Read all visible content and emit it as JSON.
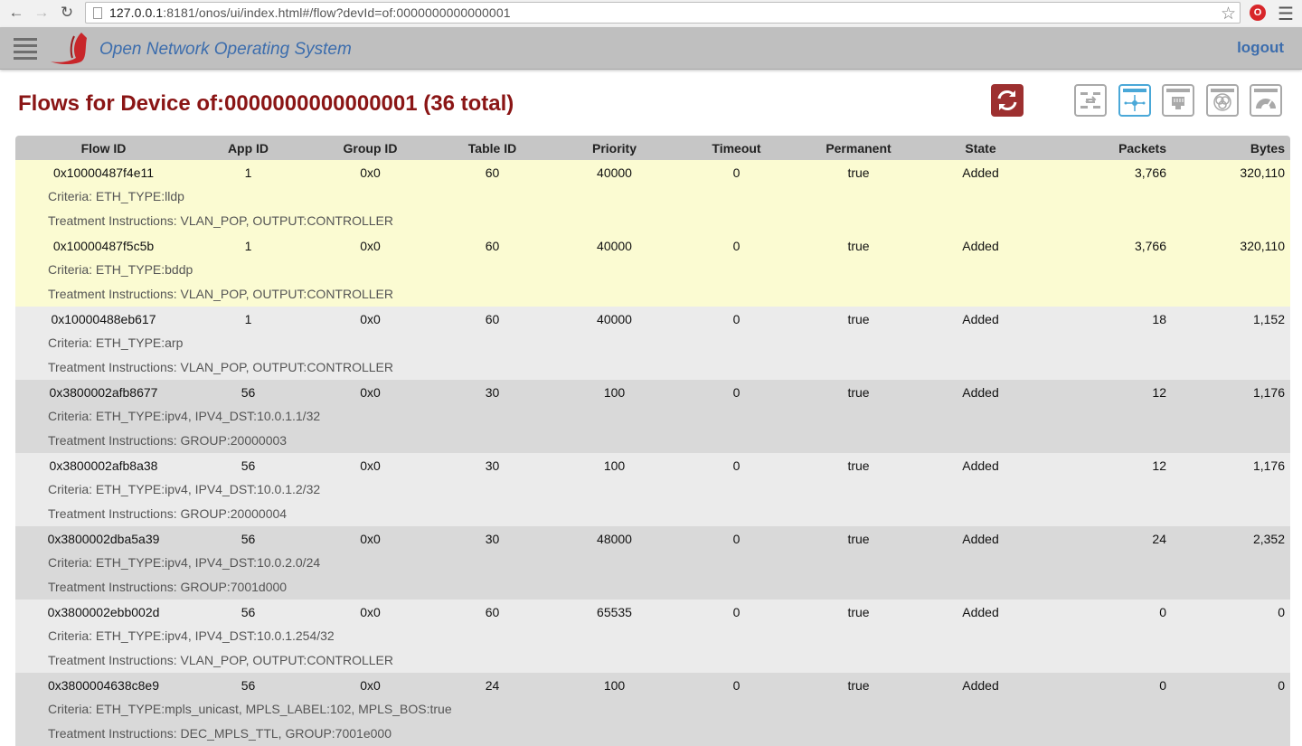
{
  "browser": {
    "url_host": "127.0.0.1",
    "url_rest": ":8181/onos/ui/index.html#/flow?devId=of:0000000000000001"
  },
  "masthead": {
    "title": "Open Network Operating System",
    "logout_label": "logout"
  },
  "page": {
    "title": "Flows for Device of:0000000000000001 (36 total)"
  },
  "table": {
    "columns": [
      "Flow ID",
      "App ID",
      "Group ID",
      "Table ID",
      "Priority",
      "Timeout",
      "Permanent",
      "State",
      "Packets",
      "Bytes"
    ],
    "rows": [
      {
        "flow_id": "0x10000487f4e11",
        "app_id": "1",
        "group_id": "0x0",
        "table_id": "60",
        "priority": "40000",
        "timeout": "0",
        "permanent": "true",
        "state": "Added",
        "packets": "3,766",
        "bytes": "320,110",
        "criteria": "Criteria: ETH_TYPE:lldp",
        "treatment": "Treatment Instructions: VLAN_POP, OUTPUT:CONTROLLER"
      },
      {
        "flow_id": "0x10000487f5c5b",
        "app_id": "1",
        "group_id": "0x0",
        "table_id": "60",
        "priority": "40000",
        "timeout": "0",
        "permanent": "true",
        "state": "Added",
        "packets": "3,766",
        "bytes": "320,110",
        "criteria": "Criteria: ETH_TYPE:bddp",
        "treatment": "Treatment Instructions: VLAN_POP, OUTPUT:CONTROLLER"
      },
      {
        "flow_id": "0x10000488eb617",
        "app_id": "1",
        "group_id": "0x0",
        "table_id": "60",
        "priority": "40000",
        "timeout": "0",
        "permanent": "true",
        "state": "Added",
        "packets": "18",
        "bytes": "1,152",
        "criteria": "Criteria: ETH_TYPE:arp",
        "treatment": "Treatment Instructions: VLAN_POP, OUTPUT:CONTROLLER"
      },
      {
        "flow_id": "0x3800002afb8677",
        "app_id": "56",
        "group_id": "0x0",
        "table_id": "30",
        "priority": "100",
        "timeout": "0",
        "permanent": "true",
        "state": "Added",
        "packets": "12",
        "bytes": "1,176",
        "criteria": "Criteria: ETH_TYPE:ipv4, IPV4_DST:10.0.1.1/32",
        "treatment": "Treatment Instructions: GROUP:20000003"
      },
      {
        "flow_id": "0x3800002afb8a38",
        "app_id": "56",
        "group_id": "0x0",
        "table_id": "30",
        "priority": "100",
        "timeout": "0",
        "permanent": "true",
        "state": "Added",
        "packets": "12",
        "bytes": "1,176",
        "criteria": "Criteria: ETH_TYPE:ipv4, IPV4_DST:10.0.1.2/32",
        "treatment": "Treatment Instructions: GROUP:20000004"
      },
      {
        "flow_id": "0x3800002dba5a39",
        "app_id": "56",
        "group_id": "0x0",
        "table_id": "30",
        "priority": "48000",
        "timeout": "0",
        "permanent": "true",
        "state": "Added",
        "packets": "24",
        "bytes": "2,352",
        "criteria": "Criteria: ETH_TYPE:ipv4, IPV4_DST:10.0.2.0/24",
        "treatment": "Treatment Instructions: GROUP:7001d000"
      },
      {
        "flow_id": "0x3800002ebb002d",
        "app_id": "56",
        "group_id": "0x0",
        "table_id": "60",
        "priority": "65535",
        "timeout": "0",
        "permanent": "true",
        "state": "Added",
        "packets": "0",
        "bytes": "0",
        "criteria": "Criteria: ETH_TYPE:ipv4, IPV4_DST:10.0.1.254/32",
        "treatment": "Treatment Instructions: VLAN_POP, OUTPUT:CONTROLLER"
      },
      {
        "flow_id": "0x3800004638c8e9",
        "app_id": "56",
        "group_id": "0x0",
        "table_id": "24",
        "priority": "100",
        "timeout": "0",
        "permanent": "true",
        "state": "Added",
        "packets": "0",
        "bytes": "0",
        "criteria": "Criteria: ETH_TYPE:mpls_unicast, MPLS_LABEL:102, MPLS_BOS:true",
        "treatment": "Treatment Instructions: DEC_MPLS_TTL, GROUP:7001e000"
      }
    ]
  }
}
